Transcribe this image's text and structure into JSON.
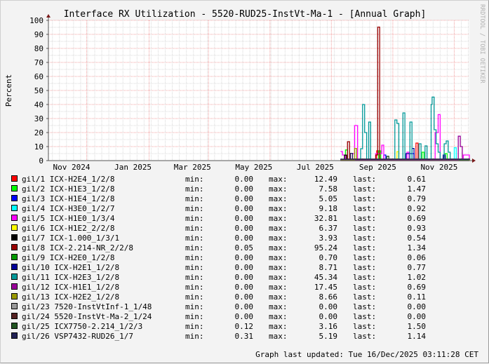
{
  "chart_data": {
    "type": "line",
    "title": "Interface RX Utilization - 5520-RUD25-InstVt-Ma-1 - [Annual Graph]",
    "ylabel": "Percent",
    "xlabel": "",
    "ylim": [
      0,
      100
    ],
    "yticks": [
      "0",
      "10",
      "20",
      "30",
      "40",
      "50",
      "60",
      "70",
      "80",
      "90",
      "100"
    ],
    "xlim": [
      "2024-10-24",
      "2025-12-16"
    ],
    "xticks": [
      {
        "label": "Nov 2024",
        "date": "2024-11-16"
      },
      {
        "label": "Jan 2025",
        "date": "2025-01-16"
      },
      {
        "label": "Mar 2025",
        "date": "2025-03-16"
      },
      {
        "label": "May 2025",
        "date": "2025-05-16"
      },
      {
        "label": "Jul 2025",
        "date": "2025-07-16"
      },
      {
        "label": "Sep 2025",
        "date": "2025-09-16"
      },
      {
        "label": "Nov 2025",
        "date": "2025-11-16"
      }
    ],
    "grid": true,
    "legend_position": "bottom",
    "watermark": "RRDTOOL / TOBI OETIKER",
    "series": [
      {
        "name": "gil/1 ICX-H2E4_1/2/8",
        "color": "#ff0000",
        "min": "0.00",
        "max": "12.49",
        "last": "0.61",
        "points": [
          [
            "2025-08-10",
            0.5
          ],
          [
            "2025-08-20",
            1
          ],
          [
            "2025-09-15",
            7
          ],
          [
            "2025-09-17",
            1
          ],
          [
            "2025-10-24",
            12.5
          ],
          [
            "2025-10-26",
            1
          ],
          [
            "2025-11-20",
            3
          ],
          [
            "2025-11-22",
            1
          ],
          [
            "2025-12-16",
            0.61
          ]
        ]
      },
      {
        "name": "gil/2 ICX-H1E3_1/2/8",
        "color": "#00ff00",
        "min": "0.00",
        "max": "7.58",
        "last": "1.47",
        "points": [
          [
            "2025-08-10",
            0.5
          ],
          [
            "2025-08-15",
            7.6
          ],
          [
            "2025-08-17",
            1
          ],
          [
            "2025-09-17",
            7
          ],
          [
            "2025-09-19",
            1
          ],
          [
            "2025-10-30",
            6
          ],
          [
            "2025-11-01",
            1
          ],
          [
            "2025-11-22",
            5
          ],
          [
            "2025-11-24",
            1
          ],
          [
            "2025-12-16",
            1.47
          ]
        ]
      },
      {
        "name": "gil/3 ICX-H1E4_1/2/8",
        "color": "#0000ff",
        "min": "0.00",
        "max": "5.05",
        "last": "0.79",
        "points": [
          [
            "2025-08-10",
            0.3
          ],
          [
            "2025-09-22",
            4
          ],
          [
            "2025-09-24",
            0.5
          ],
          [
            "2025-10-20",
            5
          ],
          [
            "2025-10-22",
            0.5
          ],
          [
            "2025-12-16",
            0.79
          ]
        ]
      },
      {
        "name": "gil/4 ICX-H3E0_1/2/7",
        "color": "#00ffff",
        "min": "0.00",
        "max": "9.18",
        "last": "0.92",
        "points": [
          [
            "2025-08-10",
            0.3
          ],
          [
            "2025-12-01",
            9.2
          ],
          [
            "2025-12-03",
            1
          ],
          [
            "2025-12-16",
            0.92
          ]
        ]
      },
      {
        "name": "gil/5 ICX-H1E0_1/3/4",
        "color": "#ff00ff",
        "min": "0.00",
        "max": "32.81",
        "last": "0.69",
        "points": [
          [
            "2025-08-10",
            6.5
          ],
          [
            "2025-08-12",
            4
          ],
          [
            "2025-08-15",
            1
          ],
          [
            "2025-08-22",
            5
          ],
          [
            "2025-08-24",
            25
          ],
          [
            "2025-08-27",
            1
          ],
          [
            "2025-09-14",
            5
          ],
          [
            "2025-09-20",
            11
          ],
          [
            "2025-09-22",
            1
          ],
          [
            "2025-10-15",
            6
          ],
          [
            "2025-10-17",
            1
          ],
          [
            "2025-11-12",
            20
          ],
          [
            "2025-11-15",
            32.8
          ],
          [
            "2025-11-17",
            1
          ],
          [
            "2025-12-10",
            4
          ],
          [
            "2025-12-16",
            0.69
          ]
        ]
      },
      {
        "name": "gil/6 ICX-H1E2_2/2/8",
        "color": "#ffff00",
        "min": "0.00",
        "max": "6.37",
        "last": "0.93",
        "points": [
          [
            "2025-08-10",
            0.3
          ],
          [
            "2025-09-20",
            1
          ],
          [
            "2025-10-05",
            6.4
          ],
          [
            "2025-10-07",
            1
          ],
          [
            "2025-12-16",
            0.93
          ]
        ]
      },
      {
        "name": "gil/7 ICX-1.000_1/3/1",
        "color": "#000000",
        "min": "0.00",
        "max": "3.93",
        "last": "0.54",
        "points": [
          [
            "2025-08-10",
            1
          ],
          [
            "2025-08-14",
            3.9
          ],
          [
            "2025-08-16",
            1
          ],
          [
            "2025-12-16",
            0.54
          ]
        ]
      },
      {
        "name": "gil/8 ICX-2.214-NR_2/2/8",
        "color": "#990000",
        "min": "0.05",
        "max": "95.24",
        "last": "1.34",
        "points": [
          [
            "2025-08-10",
            0.5
          ],
          [
            "2025-08-17",
            13.5
          ],
          [
            "2025-08-19",
            1
          ],
          [
            "2025-09-14",
            4
          ],
          [
            "2025-09-16",
            95.2
          ],
          [
            "2025-09-18",
            1
          ],
          [
            "2025-12-16",
            1.34
          ]
        ]
      },
      {
        "name": "gil/9 ICX-H2E0_1/2/8",
        "color": "#009900",
        "min": "0.00",
        "max": "0.70",
        "last": "0.06",
        "points": [
          [
            "2025-08-10",
            0.2
          ],
          [
            "2025-10-01",
            0.7
          ],
          [
            "2025-10-03",
            0.2
          ],
          [
            "2025-12-16",
            0.06
          ]
        ]
      },
      {
        "name": "gil/10 ICX-H2E1_1/2/8",
        "color": "#000099",
        "min": "0.00",
        "max": "8.71",
        "last": "0.77",
        "points": [
          [
            "2025-08-10",
            0.5
          ],
          [
            "2025-10-14",
            5
          ],
          [
            "2025-10-20",
            8.7
          ],
          [
            "2025-10-22",
            1
          ],
          [
            "2025-11-20",
            4
          ],
          [
            "2025-11-22",
            1
          ],
          [
            "2025-12-16",
            0.77
          ]
        ]
      },
      {
        "name": "gil/11 ICX-H2E3_1/2/8",
        "color": "#009999",
        "min": "0.00",
        "max": "45.34",
        "last": "1.02",
        "points": [
          [
            "2025-08-10",
            0.5
          ],
          [
            "2025-08-30",
            8.5
          ],
          [
            "2025-09-01",
            40
          ],
          [
            "2025-09-03",
            20
          ],
          [
            "2025-09-05",
            1
          ],
          [
            "2025-09-07",
            27.5
          ],
          [
            "2025-09-09",
            1
          ],
          [
            "2025-10-03",
            29
          ],
          [
            "2025-10-05",
            26.5
          ],
          [
            "2025-10-07",
            1
          ],
          [
            "2025-10-11",
            34
          ],
          [
            "2025-10-13",
            1
          ],
          [
            "2025-10-18",
            27.5
          ],
          [
            "2025-10-20",
            1
          ],
          [
            "2025-10-27",
            12
          ],
          [
            "2025-10-29",
            1
          ],
          [
            "2025-11-02",
            10.5
          ],
          [
            "2025-11-04",
            1
          ],
          [
            "2025-11-08",
            40
          ],
          [
            "2025-11-09",
            45.3
          ],
          [
            "2025-11-11",
            22
          ],
          [
            "2025-11-13",
            12
          ],
          [
            "2025-11-15",
            6
          ],
          [
            "2025-11-17",
            1
          ],
          [
            "2025-11-21",
            12
          ],
          [
            "2025-11-23",
            14
          ],
          [
            "2025-11-25",
            6
          ],
          [
            "2025-11-27",
            1
          ],
          [
            "2025-12-16",
            1.02
          ]
        ]
      },
      {
        "name": "gil/12 ICX-H1E1_1/2/8",
        "color": "#990099",
        "min": "0.00",
        "max": "17.45",
        "last": "0.69",
        "points": [
          [
            "2025-08-10",
            0.5
          ],
          [
            "2025-12-05",
            17.4
          ],
          [
            "2025-12-07",
            10
          ],
          [
            "2025-12-09",
            1
          ],
          [
            "2025-12-16",
            0.69
          ]
        ]
      },
      {
        "name": "gil/13 ICX-H2E2_1/2/8",
        "color": "#999900",
        "min": "0.00",
        "max": "8.66",
        "last": "0.11",
        "points": [
          [
            "2025-08-10",
            0.3
          ],
          [
            "2025-08-24",
            8.7
          ],
          [
            "2025-08-26",
            1
          ],
          [
            "2025-12-16",
            0.11
          ]
        ]
      },
      {
        "name": "gil/23 7520-InstVtInf-1_1/48",
        "color": "#999999",
        "min": "0.00",
        "max": "0.00",
        "last": "0.00",
        "points": [
          [
            "2025-08-10",
            0
          ],
          [
            "2025-12-16",
            0
          ]
        ]
      },
      {
        "name": "gil/24 5520-InstVt-Ma-2_1/24",
        "color": "#552222",
        "min": "0.00",
        "max": "0.00",
        "last": "0.00",
        "points": [
          [
            "2025-08-10",
            0
          ],
          [
            "2025-12-16",
            0
          ]
        ]
      },
      {
        "name": "gil/25 ICX7750-2.214_1/2/3",
        "color": "#225522",
        "min": "0.12",
        "max": "3.16",
        "last": "1.50",
        "points": [
          [
            "2025-08-10",
            1
          ],
          [
            "2025-09-25",
            3.1
          ],
          [
            "2025-09-27",
            1
          ],
          [
            "2025-12-16",
            1.5
          ]
        ]
      },
      {
        "name": "gil/26 VSP7432-RUD26_1/7",
        "color": "#222255",
        "min": "0.31",
        "max": "5.19",
        "last": "1.14",
        "points": [
          [
            "2025-08-10",
            1
          ],
          [
            "2025-08-20",
            5.2
          ],
          [
            "2025-08-22",
            1
          ],
          [
            "2025-12-16",
            1.14
          ]
        ]
      }
    ]
  },
  "legend_labels": {
    "min": "min:",
    "max": "max:",
    "last": "last:"
  },
  "footer": "Graph last updated: Tue 16/Dec/2025 03:11:28 CET"
}
